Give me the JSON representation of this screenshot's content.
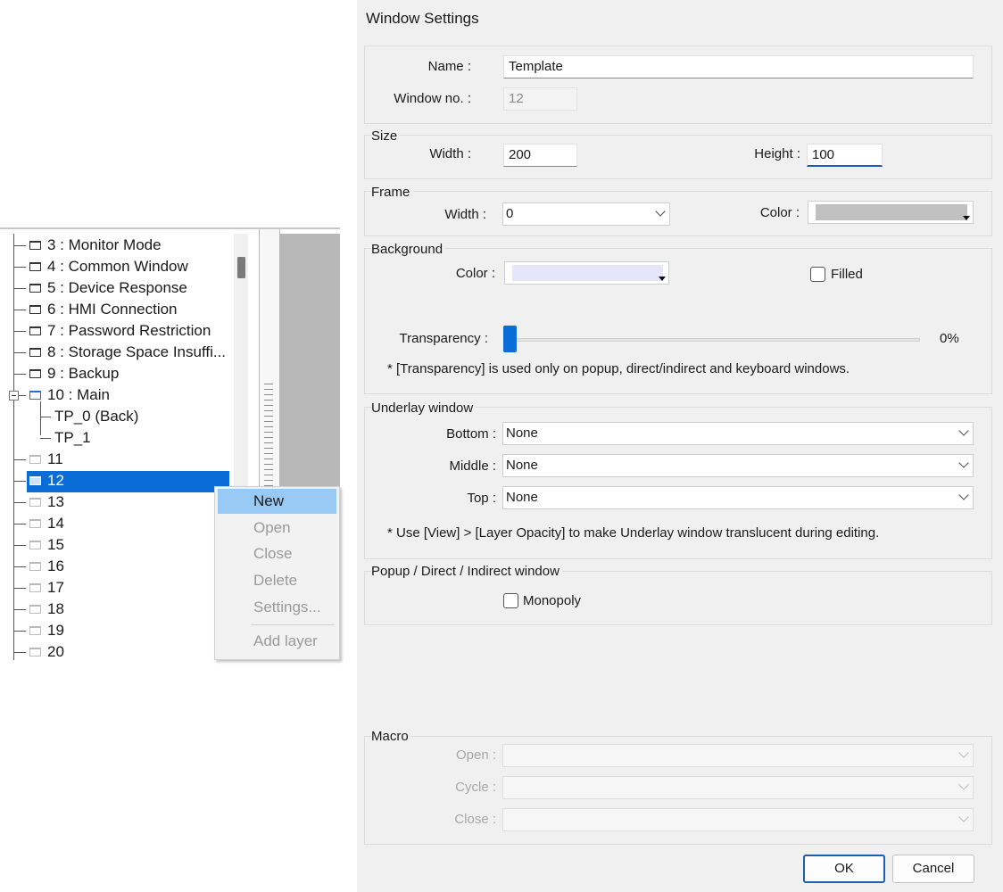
{
  "tree": {
    "items": [
      {
        "label": "3 : Monitor Mode"
      },
      {
        "label": "4 : Common Window"
      },
      {
        "label": "5 : Device Response"
      },
      {
        "label": "6 : HMI Connection"
      },
      {
        "label": "7 : Password Restriction"
      },
      {
        "label": "8 : Storage Space Insuffi..."
      },
      {
        "label": "9 : Backup"
      },
      {
        "label": "10 : Main",
        "expanded": true,
        "children": [
          {
            "label": "TP_0 (Back)"
          },
          {
            "label": "TP_1"
          }
        ]
      },
      {
        "label": "11"
      },
      {
        "label": "12",
        "selected": true
      },
      {
        "label": "13"
      },
      {
        "label": "14"
      },
      {
        "label": "15"
      },
      {
        "label": "16"
      },
      {
        "label": "17"
      },
      {
        "label": "18"
      },
      {
        "label": "19"
      },
      {
        "label": "20"
      }
    ]
  },
  "context_menu": {
    "items": [
      {
        "label": "New",
        "state": "highlighted"
      },
      {
        "label": "Open",
        "state": "disabled"
      },
      {
        "label": "Close",
        "state": "disabled"
      },
      {
        "label": "Delete",
        "state": "disabled"
      },
      {
        "label": "Settings...",
        "state": "disabled"
      },
      {
        "label": "Add layer",
        "state": "disabled"
      }
    ]
  },
  "dialog": {
    "title": "Window Settings",
    "general": {
      "name_label": "Name :",
      "name_value": "Template",
      "window_no_label": "Window no. :",
      "window_no_value": "12"
    },
    "size": {
      "title": "Size",
      "width_label": "Width :",
      "width_value": "200",
      "height_label": "Height :",
      "height_value": "100"
    },
    "frame": {
      "title": "Frame",
      "width_label": "Width :",
      "width_value": "0",
      "color_label": "Color :",
      "color_value": "#c0c0c0"
    },
    "background": {
      "title": "Background",
      "color_label": "Color :",
      "color_value": "#e6e6fa",
      "filled_label": "Filled",
      "filled_checked": false,
      "transparency_label": "Transparency :",
      "transparency_value": "0%",
      "transparency_level": 0,
      "note": "* [Transparency] is used only on popup, direct/indirect and keyboard windows."
    },
    "underlay": {
      "title": "Underlay window",
      "bottom_label": "Bottom :",
      "bottom_value": "None",
      "middle_label": "Middle :",
      "middle_value": "None",
      "top_label": "Top :",
      "top_value": "None",
      "note": "* Use [View] > [Layer Opacity] to make Underlay window translucent during editing."
    },
    "popup": {
      "title": "Popup / Direct / Indirect window",
      "monopoly_label": "Monopoly",
      "monopoly_checked": false
    },
    "macro": {
      "title": "Macro",
      "open_label": "Open :",
      "cycle_label": "Cycle :",
      "close_label": "Close :"
    },
    "buttons": {
      "ok": "OK",
      "cancel": "Cancel"
    }
  },
  "colors": {
    "selection": "#0a6cd6",
    "menu_highlight": "#99c9f5",
    "accent": "#1a5fb4"
  }
}
